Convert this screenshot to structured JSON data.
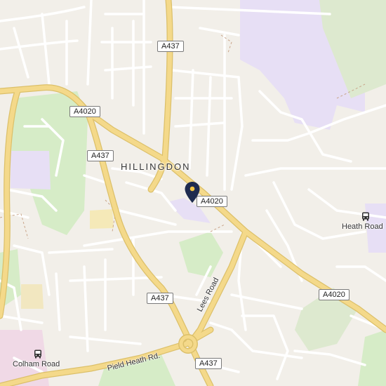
{
  "map": {
    "area_label": "HILLINGDON",
    "shields": {
      "a437_top": "A437",
      "a4020_left": "A4020",
      "a437_left": "A437",
      "a4020_center": "A4020",
      "a437_middle": "A437",
      "a4020_right": "A4020",
      "a437_bottom": "A437"
    },
    "road_names": {
      "lees_road": "Lees Road",
      "pield_heath_rd": "Pield Heath Rd."
    },
    "places": {
      "heath_road": "Heath Road",
      "colham_road": "Colham Road"
    },
    "icons": {
      "location_pin": "map-marker-icon",
      "bus_stop": "bus-icon"
    },
    "colors": {
      "background": "#f2efe9",
      "major_road": "#f4d98a",
      "major_road_casing": "#dcc06a",
      "minor_road": "#ffffff",
      "park": "#d6ecc7",
      "institution": "#e7dff5",
      "pin": "#1e2b4f"
    }
  }
}
